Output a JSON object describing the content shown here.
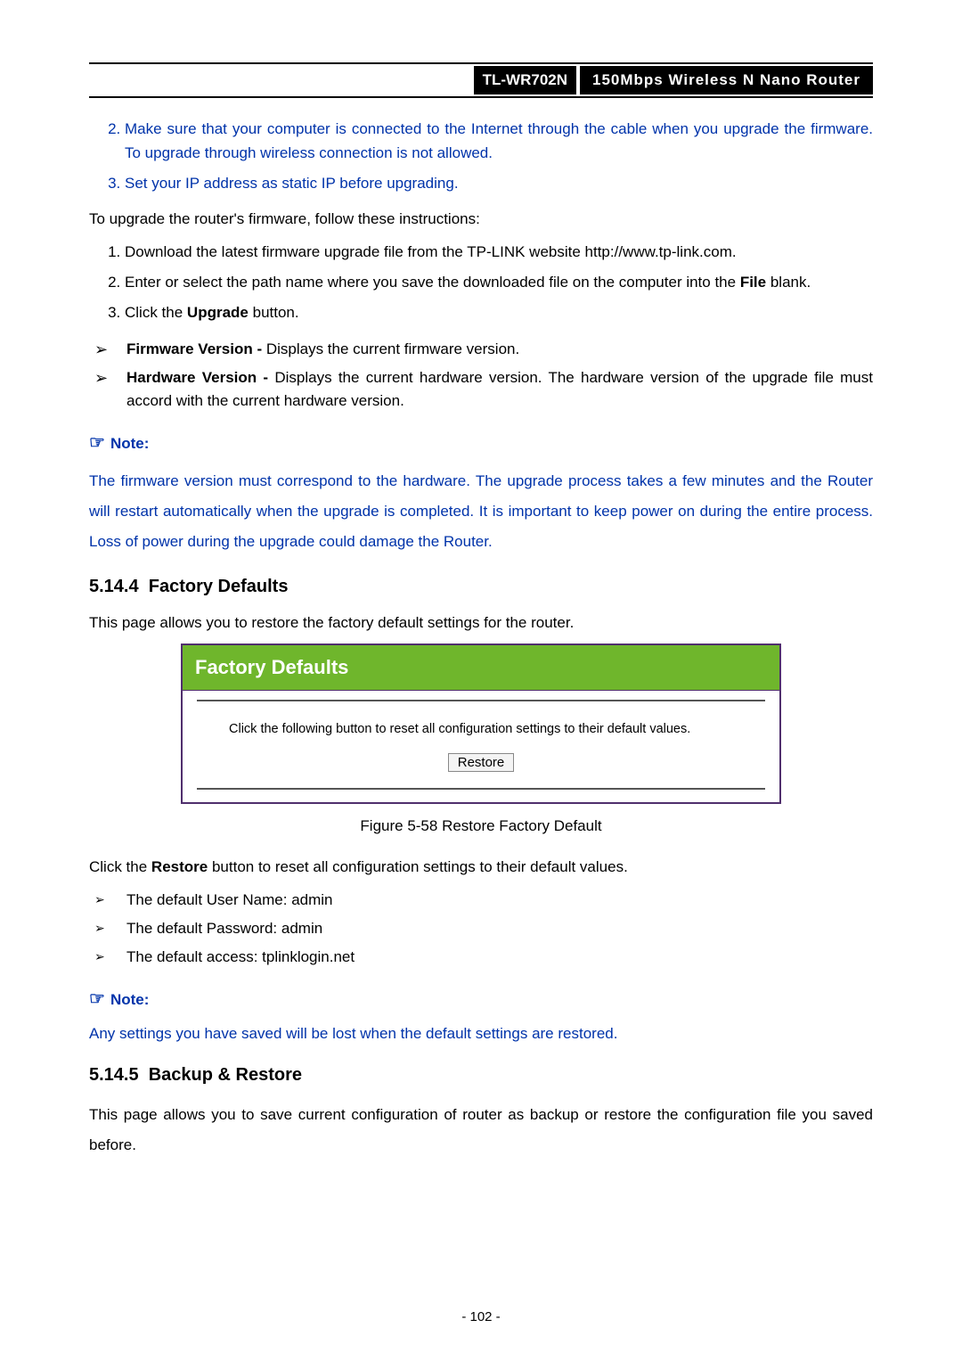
{
  "header": {
    "model": "TL-WR702N",
    "title": "150Mbps Wireless N Nano Router"
  },
  "blue_list_top": [
    {
      "num": "2.",
      "text": "Make sure that your computer is connected to the Internet through the cable when you upgrade the firmware. To upgrade through wireless connection is not allowed."
    },
    {
      "num": "3.",
      "text": "Set your IP address as static IP before upgrading."
    }
  ],
  "upgrade_intro": "To upgrade the router's firmware, follow these instructions:",
  "upgrade_steps": {
    "s1": "Download the latest firmware upgrade file from the TP-LINK website http://www.tp-link.com.",
    "s2_pre": "Enter or select the path name where you save the downloaded file on the computer into the ",
    "s2_bold": "File",
    "s2_post": " blank.",
    "s3_pre": "Click the ",
    "s3_bold": "Upgrade",
    "s3_post": " button."
  },
  "version_bullets": {
    "fw_label": "Firmware Version - ",
    "fw_text": "Displays the current firmware version.",
    "hw_label": "Hardware Version - ",
    "hw_text": "Displays the current hardware version. The hardware version of the upgrade file must accord with the current hardware version."
  },
  "note1_label": "Note:",
  "note1_text": "The firmware version must correspond to the hardware. The upgrade process takes a few minutes and the Router will restart automatically when the upgrade is completed. It is important to keep power on during the entire process. Loss of power during the upgrade could damage the Router.",
  "sec_fd_num": "5.14.4",
  "sec_fd_title": "Factory Defaults",
  "fd_intro": "This page allows you to restore the factory default settings for the router.",
  "panel": {
    "title": "Factory Defaults",
    "msg": "Click the following button to reset all configuration settings to their default values.",
    "button": "Restore"
  },
  "fig_caption": "Figure 5-58 Restore Factory Default",
  "restore_line_pre": "Click the ",
  "restore_line_bold": "Restore",
  "restore_line_post": " button to reset all configuration settings to their default values.",
  "defaults": [
    "The default User Name: admin",
    "The default Password: admin",
    "The default access: tplinklogin.net"
  ],
  "note2_label": "Note:",
  "note2_text": "Any settings you have saved will be lost when the default settings are restored.",
  "sec_br_num": "5.14.5",
  "sec_br_title": "Backup & Restore",
  "br_intro": "This page allows you to save current configuration of router as backup or restore the configuration file you saved before.",
  "page_num": "- 102 -"
}
